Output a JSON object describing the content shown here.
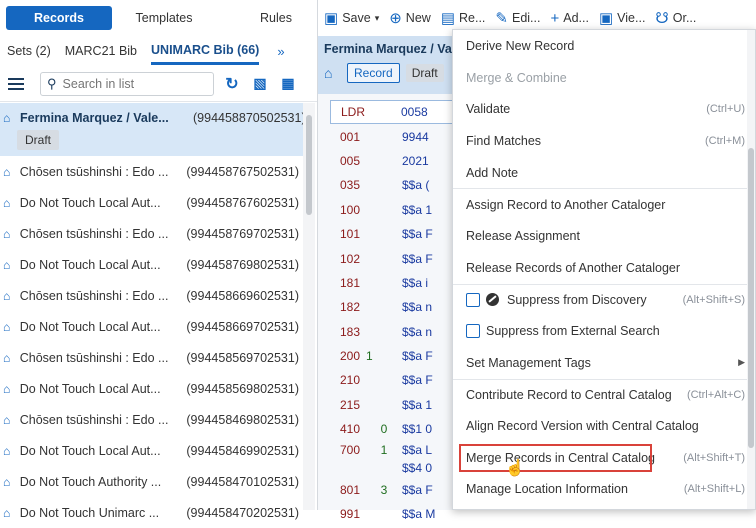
{
  "topnav": {
    "records": "Records",
    "templates": "Templates",
    "rules": "Rules"
  },
  "subtabs": {
    "sets": "Sets (2)",
    "marc21": "MARC21 Bib",
    "unimarc": "UNIMARC Bib (66)"
  },
  "search": {
    "placeholder": "Search in list"
  },
  "records": [
    {
      "title": "Fermina Marquez / Vale...",
      "id": "(994458870502531)",
      "badge": "Draft"
    },
    {
      "title": "Chōsen tsūshinshi : Edo ...",
      "id": "(994458767502531)"
    },
    {
      "title": "Do Not Touch Local Aut...",
      "id": "(994458767602531)"
    },
    {
      "title": "Chōsen tsūshinshi : Edo ...",
      "id": "(994458769702531)"
    },
    {
      "title": "Do Not Touch Local Aut...",
      "id": "(994458769802531)"
    },
    {
      "title": "Chōsen tsūshinshi : Edo ...",
      "id": "(994458669602531)"
    },
    {
      "title": "Do Not Touch Local Aut...",
      "id": "(994458669702531)"
    },
    {
      "title": "Chōsen tsūshinshi : Edo ...",
      "id": "(994458569702531)"
    },
    {
      "title": "Do Not Touch Local Aut...",
      "id": "(994458569802531)"
    },
    {
      "title": "Chōsen tsūshinshi : Edo ...",
      "id": "(994458469802531)"
    },
    {
      "title": "Do Not Touch Local Aut...",
      "id": "(994458469902531)"
    },
    {
      "title": "Do Not Touch Authority ...",
      "id": "(994458470102531)"
    },
    {
      "title": "Do Not Touch Unimarc ...",
      "id": "(994458470202531)"
    }
  ],
  "editor_toolbar": {
    "save": "Save",
    "new": "New",
    "re": "Re...",
    "edit": "Edi...",
    "add": "Ad...",
    "view": "Vie...",
    "order": "Or..."
  },
  "editor_header": {
    "title": "Fermina Marquez / Va",
    "record_badge": "Record",
    "draft_badge": "Draft"
  },
  "marc": [
    {
      "tag": "LDR",
      "ind": "",
      "val": "0058"
    },
    {
      "tag": "001",
      "ind": "",
      "val": "9944"
    },
    {
      "tag": "005",
      "ind": "",
      "val": "2021"
    },
    {
      "tag": "035",
      "ind": "",
      "val": "$$a ("
    },
    {
      "tag": "100",
      "ind": "",
      "val": "$$a 1"
    },
    {
      "tag": "101",
      "ind": "",
      "val": "$$a F"
    },
    {
      "tag": "102",
      "ind": "",
      "val": "$$a F"
    },
    {
      "tag": "181",
      "ind": "",
      "val": "$$a i"
    },
    {
      "tag": "182",
      "ind": "",
      "val": "$$a n"
    },
    {
      "tag": "183",
      "ind": "",
      "val": "$$a n"
    },
    {
      "tag": "200",
      "ind": "1",
      "val": "$$a F"
    },
    {
      "tag": "210",
      "ind": "",
      "val": "$$a F"
    },
    {
      "tag": "215",
      "ind": "",
      "val": "$$a 1"
    },
    {
      "tag": "410",
      "ind": "0",
      "val": "$$1 0"
    },
    {
      "tag": "700",
      "ind": "1",
      "val": "$$a L"
    },
    {
      "tag": "",
      "ind": "",
      "val": "$$4 0"
    },
    {
      "tag": "801",
      "ind": "3",
      "val": "$$a F"
    },
    {
      "tag": "991",
      "ind": "",
      "val": "$$a M"
    }
  ],
  "menu": {
    "derive": "Derive New Record",
    "merge_combine": "Merge & Combine",
    "validate": "Validate",
    "validate_sc": "(Ctrl+U)",
    "find": "Find Matches",
    "find_sc": "(Ctrl+M)",
    "add_note": "Add Note",
    "assign": "Assign Record to Another Cataloger",
    "release": "Release Assignment",
    "release_other": "Release Records of Another Cataloger",
    "suppress_disc": "Suppress from Discovery",
    "suppress_disc_sc": "(Alt+Shift+S)",
    "suppress_ext": "Suppress from External Search",
    "mgmt_tags": "Set Management Tags",
    "contribute": "Contribute Record to Central Catalog",
    "contribute_sc": "(Ctrl+Alt+C)",
    "align": "Align Record Version with Central Catalog",
    "merge_cc": "Merge Records in Central Catalog",
    "merge_cc_sc": "(Alt+Shift+T)",
    "location": "Manage Location Information",
    "location_sc": "(Alt+Shift+L)"
  }
}
